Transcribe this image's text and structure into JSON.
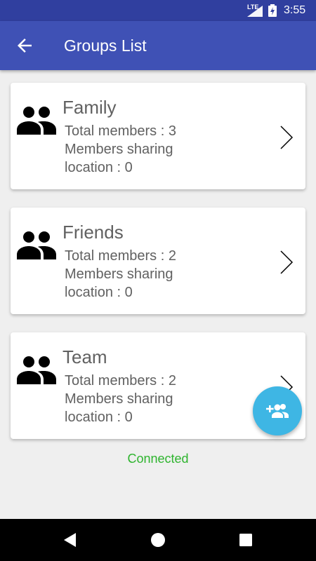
{
  "status_bar": {
    "network": "LTE",
    "time": "3:55"
  },
  "app_bar": {
    "title": "Groups List"
  },
  "groups": [
    {
      "name": "Family",
      "total_members": "Total members : 3",
      "sharing_line1": "Members sharing",
      "sharing_line2": "location : 0"
    },
    {
      "name": "Friends",
      "total_members": "Total members : 2",
      "sharing_line1": "Members sharing",
      "sharing_line2": "location : 0"
    },
    {
      "name": "Team",
      "total_members": "Total members : 2",
      "sharing_line1": "Members sharing",
      "sharing_line2": "location : 0"
    }
  ],
  "connection_status": "Connected",
  "colors": {
    "app_bar": "#3f51b5",
    "status_bar": "#303f9f",
    "fab": "#3eb6e4",
    "connected": "#2eb42e"
  },
  "icons": {
    "back": "arrow-back-icon",
    "group": "group-icon",
    "chevron": "chevron-right-icon",
    "fab": "group-add-icon"
  }
}
